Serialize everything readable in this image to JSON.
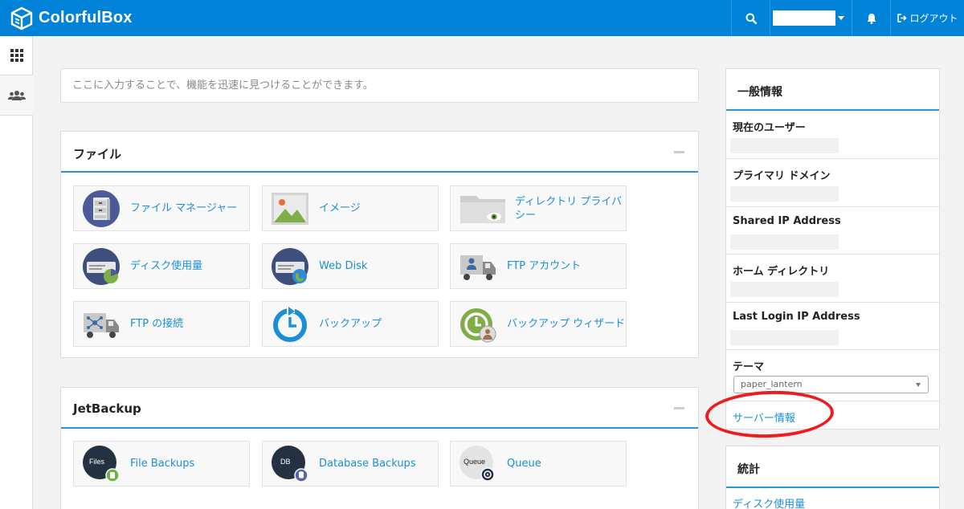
{
  "header": {
    "brand": "ColorfulBox",
    "logout_label": "ログアウト"
  },
  "search": {
    "placeholder": "ここに入力することで、機能を迅速に見つけることができます。"
  },
  "files_panel": {
    "title": "ファイル",
    "tiles": [
      {
        "label": "ファイル マネージャー",
        "icon": "file-manager-icon"
      },
      {
        "label": "イメージ",
        "icon": "image-icon"
      },
      {
        "label": "ディレクトリ プライバシー",
        "icon": "directory-privacy-icon"
      },
      {
        "label": "ディスク使用量",
        "icon": "disk-usage-icon"
      },
      {
        "label": "Web Disk",
        "icon": "web-disk-icon"
      },
      {
        "label": "FTP アカウント",
        "icon": "ftp-accounts-icon"
      },
      {
        "label": "FTP の接続",
        "icon": "ftp-connections-icon"
      },
      {
        "label": "バックアップ",
        "icon": "backup-icon"
      },
      {
        "label": "バックアップ ウィザード",
        "icon": "backup-wizard-icon"
      }
    ]
  },
  "jetbackup_panel": {
    "title": "JetBackup",
    "tiles": [
      {
        "label": "File Backups",
        "badge": "Files",
        "icon": "file-backups-icon"
      },
      {
        "label": "Database Backups",
        "badge": "DB",
        "icon": "database-backups-icon"
      },
      {
        "label": "Queue",
        "badge": "Queue",
        "icon": "queue-icon"
      }
    ]
  },
  "general_info": {
    "title": "一般情報",
    "rows": [
      {
        "label": "現在のユーザー"
      },
      {
        "label": "プライマリ ドメイン"
      },
      {
        "label": "Shared IP Address"
      },
      {
        "label": "ホーム ディレクトリ"
      },
      {
        "label": "Last Login IP Address"
      }
    ],
    "theme_label": "テーマ",
    "theme_value": "paper_lantern",
    "server_info_link": "サーバー情報"
  },
  "stats": {
    "title": "統計",
    "first_item": "ディスク使用量"
  },
  "colors": {
    "topbar": "#0082d9",
    "accent": "#2a96d6",
    "link": "#1b8fd6",
    "annotation": "#ee1c1c"
  }
}
